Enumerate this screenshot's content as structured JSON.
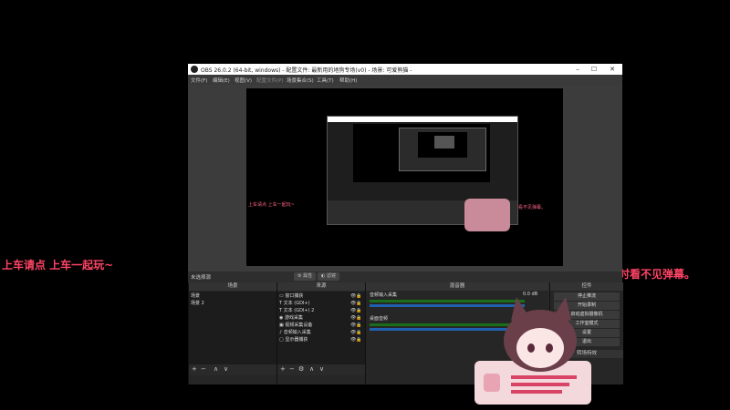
{
  "overlay": {
    "left_text": "上车请点 上车一起玩~",
    "right_text": "打游戏认真时看不见弹幕。"
  },
  "window": {
    "title": "OBS 26.0.2 (64-bit, windows) - 配置文件: 最新用的地狗专场(v0) - 场景: 可爱熊猫 - ",
    "controls": {
      "minimize": "–",
      "maximize": "☐",
      "close": "✕"
    }
  },
  "menu": [
    "文件(F)",
    "编辑(E)",
    "视图(V)",
    "配置文件(P)",
    "场景集合(S)",
    "工具(T)",
    "帮助(H)"
  ],
  "preview": {
    "nested_left_text": "上车请点 上车一起玩~",
    "nested_right_text": "打游戏认真时看不见弹幕。"
  },
  "toolbar": {
    "status_label": "未选择源",
    "properties_label": "属性",
    "filters_label": "滤镜"
  },
  "scenes": {
    "header": "场景",
    "items": [
      "场景",
      "场景 2"
    ]
  },
  "sources": {
    "header": "来源",
    "items": [
      {
        "icon": "window-capture-icon",
        "label": "窗口捕获"
      },
      {
        "icon": "text-icon",
        "label": "文本 (GDI+)"
      },
      {
        "icon": "text-icon",
        "label": "文本 (GDI+) 2"
      },
      {
        "icon": "camera-icon",
        "label": "游戏采集"
      },
      {
        "icon": "video-device-icon",
        "label": "视频采集设备"
      },
      {
        "icon": "mic-icon",
        "label": "音频输入采集"
      },
      {
        "icon": "monitor-icon",
        "label": "显示器捕获"
      }
    ]
  },
  "mixer": {
    "header": "混音器",
    "tracks": [
      {
        "name": "音频输入采集",
        "level": "0.0 dB"
      },
      {
        "name": "桌面音频",
        "level": ""
      }
    ]
  },
  "controls": {
    "header": "控件",
    "buttons": [
      "停止推流",
      "开始录制",
      "启动虚拟摄像机",
      "工作室模式",
      "设置",
      "退出"
    ]
  },
  "transitions": {
    "header": "转场特效"
  },
  "footer": {
    "add": "+",
    "remove": "−",
    "up": "∧",
    "down": "∨",
    "gear": "⚙"
  },
  "colors": {
    "accent": "#ff4466",
    "window_bg": "#2b2b2b",
    "meter_green": "#1a6e1a",
    "meter_blue": "#2060b0"
  }
}
